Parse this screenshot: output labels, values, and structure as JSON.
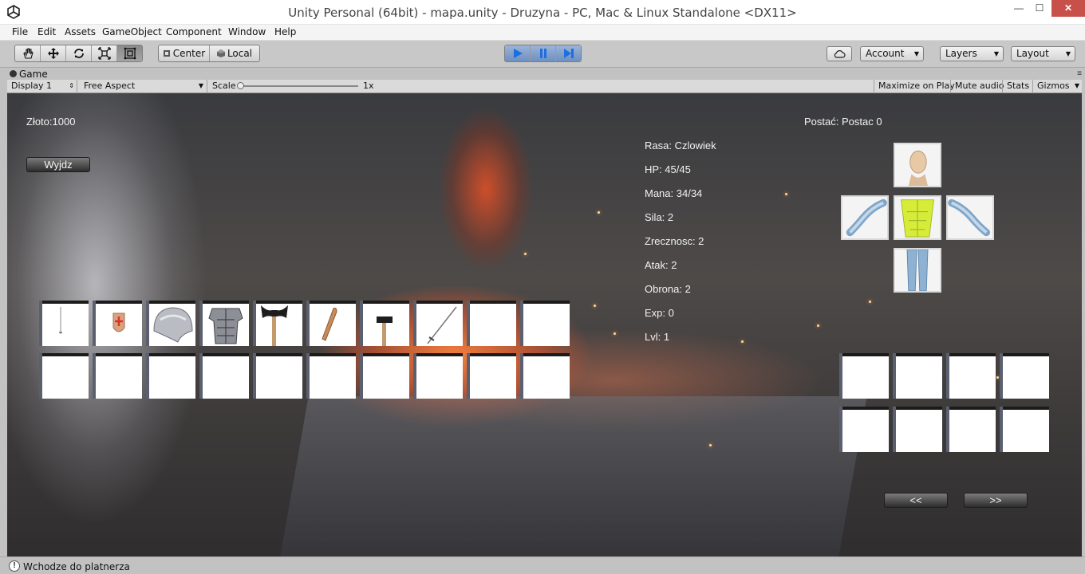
{
  "window": {
    "title": "Unity Personal (64bit) - mapa.unity - Druzyna - PC, Mac & Linux Standalone <DX11>",
    "controls": [
      "—",
      "☐",
      "✕"
    ]
  },
  "menu": [
    "File",
    "Edit",
    "Assets",
    "GameObject",
    "Component",
    "Window",
    "Help"
  ],
  "toolbar": {
    "tools": [
      "hand-tool-icon",
      "move-tool-icon",
      "rotate-tool-icon",
      "scale-tool-icon",
      "rect-tool-icon"
    ],
    "pivot_label": "Center",
    "space_label": "Local",
    "account_label": "Account",
    "layers_label": "Layers",
    "layout_label": "Layout"
  },
  "game_panel": {
    "tab_label": "Game",
    "display": "Display 1",
    "aspect": "Free Aspect",
    "scale_label": "Scale",
    "scale_value": "1x",
    "maximize_label": "Maximize on Play",
    "mute_label": "Mute audio",
    "stats_label": "Stats",
    "gizmos_label": "Gizmos"
  },
  "game": {
    "gold": "Złoto:1000",
    "exit_button": "Wyjdz",
    "character_label": "Postać: Postac 0",
    "stats": [
      "Rasa: Czlowiek",
      "HP: 45/45",
      "Mana: 34/34",
      "Sila: 2",
      "Zrecznosc: 2",
      "Atak: 2",
      "Obrona: 2",
      "Exp: 0",
      "Lvl: 1"
    ],
    "shop_items": [
      "needle-item",
      "shield-item",
      "helmet-item",
      "armor-item",
      "axe-item",
      "club-item",
      "hammer-item",
      "sword-item",
      "",
      ""
    ],
    "prev_button": "<<",
    "next_button": ">>"
  },
  "status": {
    "message": "Wchodze do platnerza"
  },
  "colors": {
    "close_button": "#c7504a",
    "play_active": "#6f8fbe"
  }
}
